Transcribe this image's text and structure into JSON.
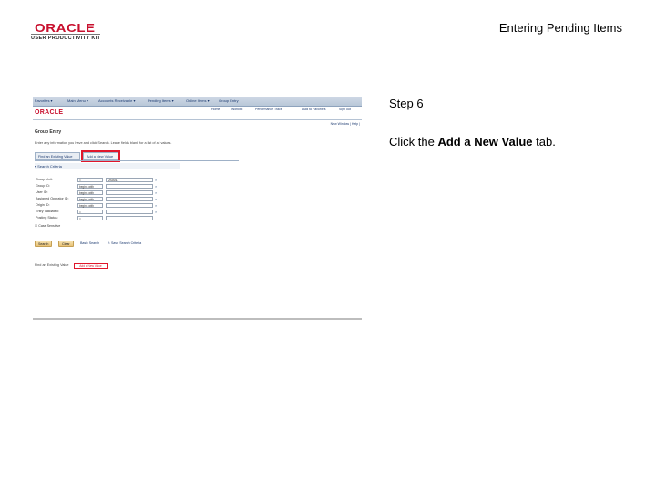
{
  "header": {
    "doc_title": "Entering Pending Items",
    "logo_name": "ORACLE",
    "logo_tagline": "USER PRODUCTIVITY KIT"
  },
  "screenshot": {
    "menubar": [
      "Favorites ▾",
      "Main Menu ▾",
      "Accounts Receivable ▾",
      "Pending Items ▾",
      "Online Items ▾",
      "Group Entry"
    ],
    "brand": "ORACLE",
    "top_links": [
      "Home",
      "Worklist",
      "Performance Trace",
      "Add to Favorites",
      "Sign out"
    ],
    "util_links": "New Window | Help | ",
    "page_title": "Group Entry",
    "instructions": "Enter any information you have and click Search. Leave fields blank for a list of all values.",
    "tabs": {
      "find": "Find an Existing Value",
      "add": "Add a New Value"
    },
    "search_criteria": "Search Criteria",
    "fields": [
      {
        "label": "Group Unit:",
        "op": "=",
        "value": "US001"
      },
      {
        "label": "Group ID:",
        "op": "begins with",
        "value": ""
      },
      {
        "label": "User ID:",
        "op": "begins with",
        "value": ""
      },
      {
        "label": "Assigned Operator ID:",
        "op": "begins with",
        "value": ""
      },
      {
        "label": "Origin ID:",
        "op": "begins with",
        "value": ""
      },
      {
        "label": "Entry Validated:",
        "op": "=",
        "value": ""
      },
      {
        "label": "Posting Status:",
        "op": "=",
        "value": ""
      }
    ],
    "case_sensitive": "Case Sensitive",
    "buttons": {
      "search": "Search",
      "clear": "Clear"
    },
    "links": {
      "basic": "Basic Search",
      "save": "Save Search Criteria"
    },
    "bottom_find": "Find an Existing Value",
    "bottom_add": "Add a New Value"
  },
  "step": {
    "title": "Step 6",
    "instruction_before": "Click the ",
    "instruction_bold": "Add a New Value",
    "instruction_after": " tab."
  },
  "colors": {
    "oracle_red": "#c8102e",
    "highlight": "#e0162b"
  }
}
